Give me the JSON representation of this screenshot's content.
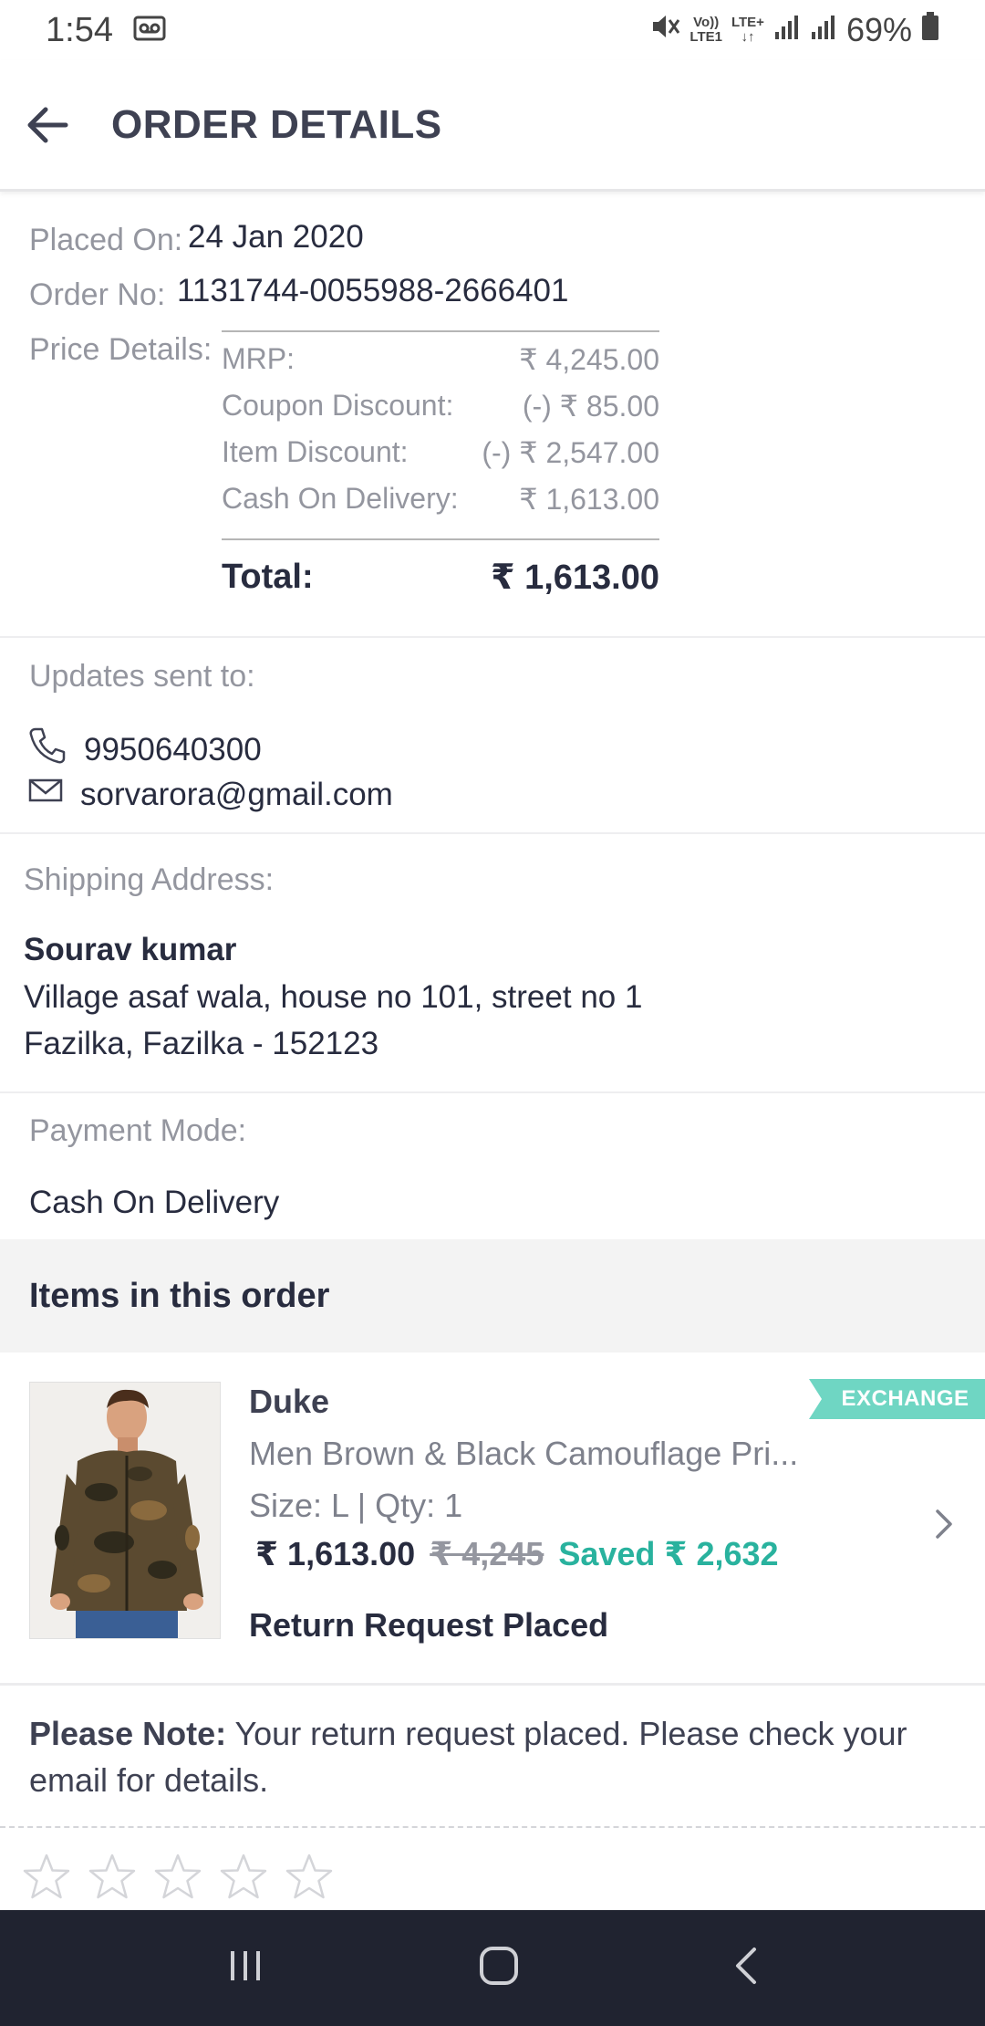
{
  "status_bar": {
    "time": "1:54",
    "network_top": "Vo))",
    "network_sub": "LTE1",
    "lte_top": "LTE+",
    "lte_sub": "↓↑",
    "battery": "69%"
  },
  "app_bar": {
    "title": "ORDER DETAILS"
  },
  "order": {
    "placed_on_label": "Placed On:",
    "placed_on_value": "24 Jan 2020",
    "order_no_label": "Order No:",
    "order_no_value": "1131744-0055988-2666401",
    "price_details_label": "Price Details:"
  },
  "price_details": {
    "rows": [
      {
        "label": "MRP:",
        "value": "₹ 4,245.00"
      },
      {
        "label": "Coupon Discount:",
        "value": "(-) ₹ 85.00"
      },
      {
        "label": "Item Discount:",
        "value": "(-) ₹ 2,547.00"
      },
      {
        "label": "Cash On Delivery:",
        "value": "₹ 1,613.00"
      }
    ],
    "total_label": "Total:",
    "total_value": "₹ 1,613.00"
  },
  "updates": {
    "label": "Updates sent to:",
    "phone": "9950640300",
    "email": "sorvarora@gmail.com"
  },
  "shipping": {
    "label": "Shipping Address:",
    "name": "Sourav kumar",
    "line1": "Village asaf wala, house no 101, street no 1",
    "line2": "Fazilka, Fazilka - 152123"
  },
  "payment": {
    "label": "Payment Mode:",
    "value": "Cash On Delivery"
  },
  "items": {
    "header": "Items in this order",
    "list": [
      {
        "badge": "EXCHANGE",
        "brand": "Duke",
        "name": "Men Brown & Black Camouflage Pri...",
        "size_qty": "Size: L | Qty: 1",
        "price": "₹ 1,613.00",
        "mrp": "₹ 4,245",
        "saved": "Saved ₹ 2,632",
        "status": "Return Request Placed"
      }
    ]
  },
  "note": {
    "title": "Please Note:",
    "text": " Your return request placed. Please check your email for details."
  },
  "rating": {
    "stars": 5,
    "filled": 0
  },
  "colors": {
    "accent_green": "#29b29e",
    "badge_green": "#6fd6c3",
    "text_dark": "#282c3f",
    "text_muted": "#94969f",
    "navbar": "#202330"
  }
}
